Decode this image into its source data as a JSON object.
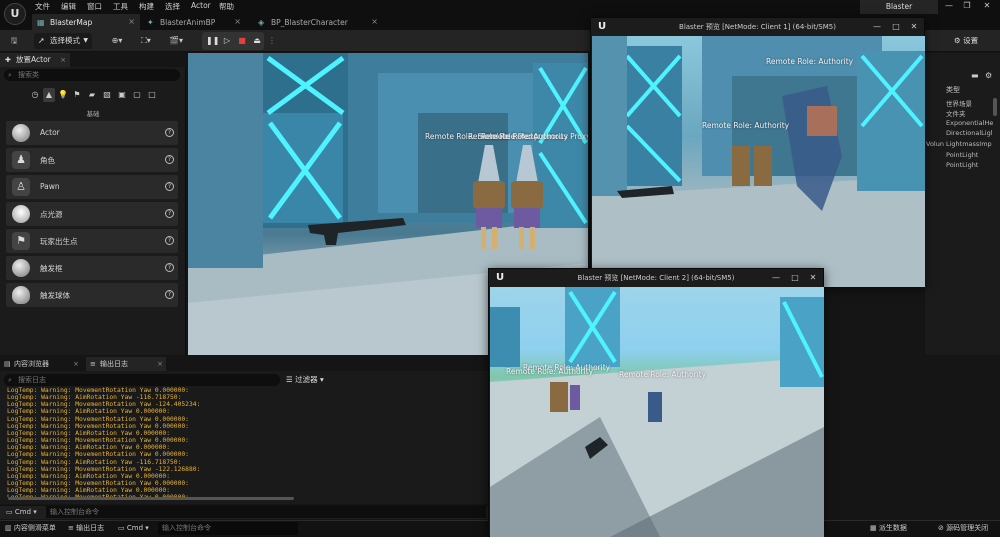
{
  "menu": [
    "文件",
    "编辑",
    "窗口",
    "工具",
    "构建",
    "选择",
    "Actor",
    "帮助"
  ],
  "doc_tabs": [
    "BlasterMap",
    "BlasterAnimBP",
    "BP_BlasterCharacter"
  ],
  "project_name": "Blaster",
  "toolbar": {
    "mode_label": "选择模式",
    "settings_label": "设置"
  },
  "place_panel": {
    "tab_label": "放置Actor",
    "search_placeholder": "搜索类",
    "category_label": "基础",
    "items": [
      "Actor",
      "角色",
      "Pawn",
      "点光源",
      "玩家出生点",
      "触发框",
      "触发球体"
    ]
  },
  "outliner": {
    "type_header": "类型",
    "items": [
      "世界场景",
      "文件夹",
      "ExponentialHe",
      "DirectionalLigl",
      "LightmassImp",
      "PointLight",
      "PointLight"
    ],
    "volume_fragment": "Volun"
  },
  "viewport": {
    "labels": [
      "Remote Role: Simulated Proxy",
      "Remote Role: Autonomous Proxy",
      "Remote Role: Authority"
    ]
  },
  "bottom_tabs": [
    "内容浏览器",
    "输出日志"
  ],
  "log": {
    "search_placeholder": "搜索日志",
    "filter_label": "过滤器",
    "lines": [
      "LogTemp: Warning: MovementRotation Yaw 0.000000:",
      "LogTemp: Warning: AimRotation Yaw -116.718750:",
      "LogTemp: Warning: MovementRotation Yaw -124.405234:",
      "LogTemp: Warning: AimRotation Yaw 0.000000:",
      "LogTemp: Warning: MovementRotation Yaw 0.000000:",
      "LogTemp: Warning: MovementRotation Yaw 0.000000:",
      "LogTemp: Warning: AimRotation Yaw 0.000000:",
      "LogTemp: Warning: MovementRotation Yaw 0.000000:",
      "LogTemp: Warning: AimRotation Yaw 0.000000:",
      "LogTemp: Warning: MovementRotation Yaw 0.000000:",
      "LogTemp: Warning: AimRotation Yaw -116.718750:",
      "LogTemp: Warning: MovementRotation Yaw -122.126880:",
      "LogTemp: Warning: AimRotation Yaw 0.000000:",
      "LogTemp: Warning: MovementRotation Yaw 0.000000:",
      "LogTemp: Warning: AimRotation Yaw 0.000000:",
      "LogTemp: Warning: MovementRotation Yaw 0.000000:"
    ],
    "cmd_label": "Cmd",
    "cmd_placeholder": "输入控制台命令"
  },
  "statusbar": {
    "content_drawer": "内容侧滑菜单",
    "output_log": "输出日志",
    "cmd_label": "Cmd",
    "cmd_placeholder": "输入控制台命令",
    "derived_data": "派生数据",
    "source_control": "源码管理关闭"
  },
  "pie1": {
    "title": "Blaster 预览 [NetMode: Client 1]  (64-bit/SM5)",
    "labels": [
      "Remote Role: Authority",
      "Remote Role: Authority"
    ]
  },
  "pie2": {
    "title": "Blaster 预览 [NetMode: Client 2]  (64-bit/SM5)",
    "labels": [
      "Remote Role: Authority",
      "Remote Role: Authority",
      "Remote Role: Authority"
    ]
  },
  "colors": {
    "log_warning": "#e8b338",
    "neon": "#4ff3ff",
    "accent": "#d44"
  }
}
